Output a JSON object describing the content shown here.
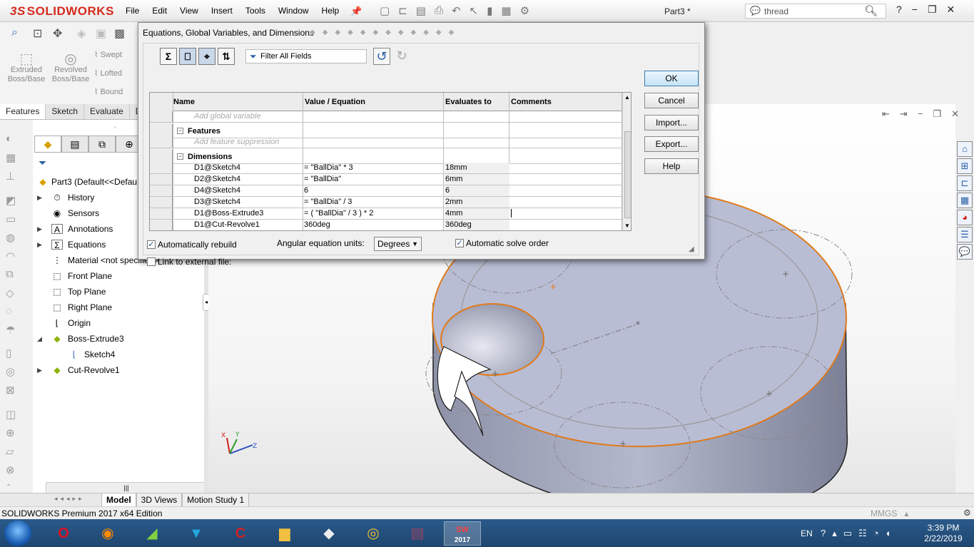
{
  "app": {
    "logo_prefix": "3S",
    "logo_text": "SOLIDWORKS",
    "menu": [
      "File",
      "Edit",
      "View",
      "Insert",
      "Tools",
      "Window",
      "Help"
    ],
    "doc_title": "Part3 *",
    "search": {
      "value": "thread"
    }
  },
  "commands": {
    "extruded": "Extruded Boss/Base",
    "revolved": "Revolved Boss/Base",
    "swept": "Swept",
    "lofted": "Lofted",
    "boundary": "Bound"
  },
  "tabs": [
    "Features",
    "Sketch",
    "Evaluate",
    "D"
  ],
  "tree": {
    "root": "Part3  (Default<<Defau",
    "items": [
      {
        "label": "History",
        "icon": "history-icon"
      },
      {
        "label": "Sensors",
        "icon": "sensors-icon"
      },
      {
        "label": "Annotations",
        "icon": "annotations-icon"
      },
      {
        "label": "Equations",
        "icon": "equations-icon"
      },
      {
        "label": "Material <not specified>",
        "icon": "material-icon"
      },
      {
        "label": "Front Plane",
        "icon": "plane-icon"
      },
      {
        "label": "Top Plane",
        "icon": "plane-icon"
      },
      {
        "label": "Right Plane",
        "icon": "plane-icon"
      },
      {
        "label": "Origin",
        "icon": "origin-icon"
      },
      {
        "label": "Boss-Extrude3",
        "icon": "extrude-icon"
      },
      {
        "label": "Sketch4",
        "icon": "sketch-icon"
      },
      {
        "label": "Cut-Revolve1",
        "icon": "revolve-icon"
      }
    ]
  },
  "dialog": {
    "title": "Equations, Global Variables, and Dimensions",
    "filter_placeholder": "Filter All Fields",
    "columns": [
      "Name",
      "Value / Equation",
      "Evaluates to",
      "Comments"
    ],
    "global_placeholder": "Add global variable",
    "features_label": "Features",
    "feature_placeholder": "Add feature suppression",
    "dimensions_label": "Dimensions",
    "rows": [
      {
        "name": "D1@Sketch4",
        "value": "= \"BallDia\" * 3",
        "eval": "18mm",
        "comment": ""
      },
      {
        "name": "D2@Sketch4",
        "value": "= \"BallDia\"",
        "eval": "6mm",
        "comment": ""
      },
      {
        "name": "D4@Sketch4",
        "value": "6",
        "eval": "6",
        "comment": ""
      },
      {
        "name": "D3@Sketch4",
        "value": "= \"BallDia\" / 3",
        "eval": "2mm",
        "comment": ""
      },
      {
        "name": "D1@Boss-Extrude3",
        "value": "= ( \"BallDia\" / 3 ) * 2",
        "eval": "4mm",
        "comment": ""
      },
      {
        "name": "D1@Cut-Revolve1",
        "value": "360deg",
        "eval": "360deg",
        "comment": ""
      }
    ],
    "buttons": {
      "ok": "OK",
      "cancel": "Cancel",
      "import": "Import...",
      "export": "Export...",
      "help": "Help"
    },
    "auto_rebuild": "Automatically rebuild",
    "angular_units_label": "Angular equation units:",
    "angular_units_value": "Degrees",
    "auto_solve": "Automatic solve order",
    "link_external": "Link to external file:"
  },
  "bottom_tabs": [
    "Model",
    "3D Views",
    "Motion Study 1"
  ],
  "status": {
    "edition": "SOLIDWORKS Premium 2017 x64 Edition",
    "units": "MMGS"
  },
  "taskbar": {
    "lang": "EN",
    "time": "3:39 PM",
    "date": "2/22/2019",
    "sw_version": "2017"
  },
  "colors": {
    "accent": "#d52b1e",
    "taskbar": "#1f4670",
    "part": "#b9bdd4",
    "edge": "#e07a1b"
  }
}
